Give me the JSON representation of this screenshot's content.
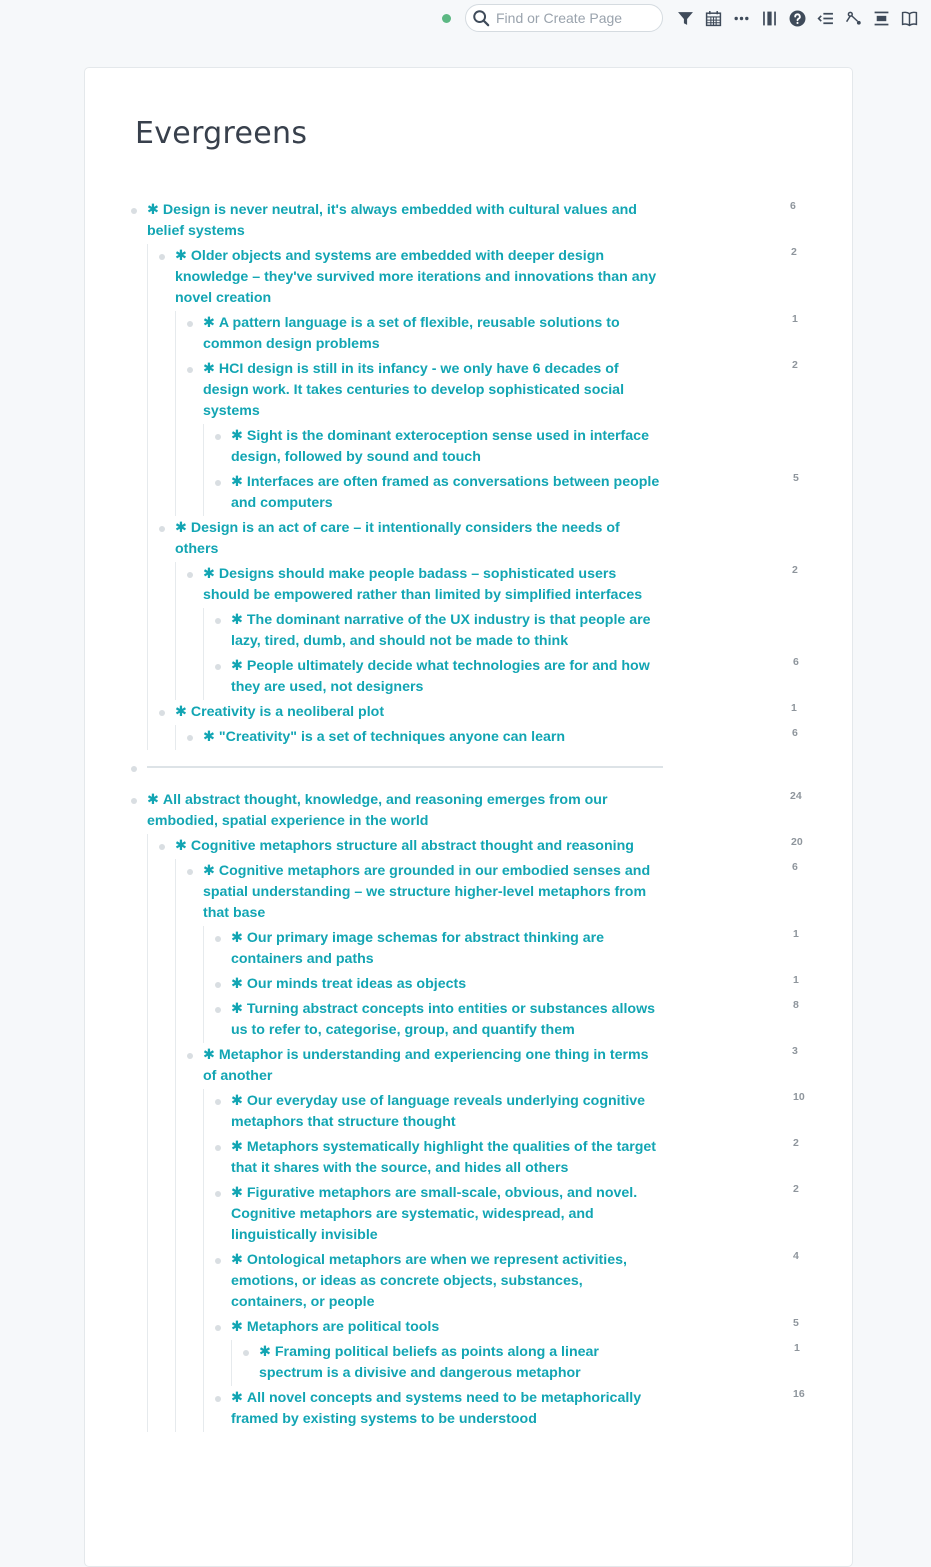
{
  "topbar": {
    "sync_status": "synced",
    "sync_color": "#5cb883",
    "search_placeholder": "Find or Create Page",
    "icons": [
      {
        "name": "filter-icon"
      },
      {
        "name": "calendar-icon"
      },
      {
        "name": "more-icon"
      },
      {
        "name": "sidebar-toggle-icon"
      },
      {
        "name": "help-icon"
      },
      {
        "name": "outline-indent-icon"
      },
      {
        "name": "graph-icon"
      },
      {
        "name": "align-icon"
      },
      {
        "name": "book-icon"
      }
    ]
  },
  "page": {
    "title": "Evergreens",
    "accent_color": "#12a5b3"
  },
  "blocks": [
    {
      "text": "Design is never neutral, it's always embedded with cultural values and belief systems",
      "count": "6",
      "children": [
        {
          "text": "Older objects and systems are embedded with deeper design knowledge – they've survived more iterations and innovations than any novel creation",
          "count": "2",
          "children": [
            {
              "text": "A pattern language is a set of flexible, reusable solutions to common design problems",
              "count": "1",
              "children": []
            },
            {
              "text": "HCI design is still in its infancy - we only have 6 decades of design work. It takes centuries to develop sophisticated social systems",
              "count": "2",
              "children": [
                {
                  "text": "Sight is the dominant exteroception sense used in interface design, followed by sound and touch",
                  "count": "",
                  "children": []
                },
                {
                  "text": "Interfaces are often framed as conversations between people and computers",
                  "count": "5",
                  "children": []
                }
              ]
            }
          ]
        },
        {
          "text": "Design is an act of care – it intentionally considers the needs of others",
          "count": "",
          "children": [
            {
              "text": "Designs should make people badass – sophisticated users should be empowered rather than limited by simplified interfaces",
              "count": "2",
              "children": [
                {
                  "text": "The dominant narrative of the UX industry is that people are lazy, tired, dumb, and should not be made to think",
                  "count": "",
                  "children": []
                },
                {
                  "text": "People ultimately decide what technologies are for and how they are used, not designers",
                  "count": "6",
                  "children": []
                }
              ]
            }
          ]
        },
        {
          "text": "Creativity is a neoliberal plot",
          "count": "1",
          "children": [
            {
              "text": "\"Creativity\" is a set of techniques anyone can learn",
              "count": "6",
              "children": []
            }
          ]
        }
      ]
    },
    {
      "divider": true
    },
    {
      "text": "All abstract thought, knowledge, and reasoning emerges from our embodied, spatial experience in the world",
      "count": "24",
      "children": [
        {
          "text": "Cognitive metaphors structure all abstract thought and reasoning",
          "count": "20",
          "children": [
            {
              "text": "Cognitive metaphors are grounded in our embodied senses and spatial understanding – we structure higher-level metaphors from that base",
              "count": "6",
              "children": [
                {
                  "text": "Our primary image schemas for abstract thinking are containers and paths",
                  "count": "1",
                  "children": []
                },
                {
                  "text": "Our minds treat ideas as objects",
                  "count": "1",
                  "children": []
                },
                {
                  "text": "Turning abstract concepts into entities or substances allows us to refer to, categorise, group, and quantify them",
                  "count": "8",
                  "children": []
                }
              ]
            },
            {
              "text": "Metaphor is understanding and experiencing one thing in terms of another",
              "count": "3",
              "children": [
                {
                  "text": "Our everyday use of language reveals underlying cognitive metaphors that structure thought",
                  "count": "10",
                  "children": []
                },
                {
                  "text": "Metaphors systematically highlight the qualities of the target that it shares with the source, and hides all others",
                  "count": "2",
                  "children": []
                },
                {
                  "text": "Figurative metaphors are small-scale, obvious, and novel. Cognitive metaphors are systematic, widespread, and linguistically invisible",
                  "count": "2",
                  "children": []
                },
                {
                  "text": "Ontological metaphors are when we represent activities, emotions, or ideas as concrete objects, substances, containers, or people",
                  "count": "4",
                  "children": []
                },
                {
                  "text": "Metaphors are political tools",
                  "count": "5",
                  "children": [
                    {
                      "text": "Framing political beliefs as points along a linear spectrum is a divisive and dangerous metaphor",
                      "count": "1",
                      "children": []
                    }
                  ]
                },
                {
                  "text": "All novel concepts and systems need to be metaphorically framed by existing systems to be understood",
                  "count": "16",
                  "children": []
                }
              ]
            }
          ]
        }
      ]
    }
  ]
}
